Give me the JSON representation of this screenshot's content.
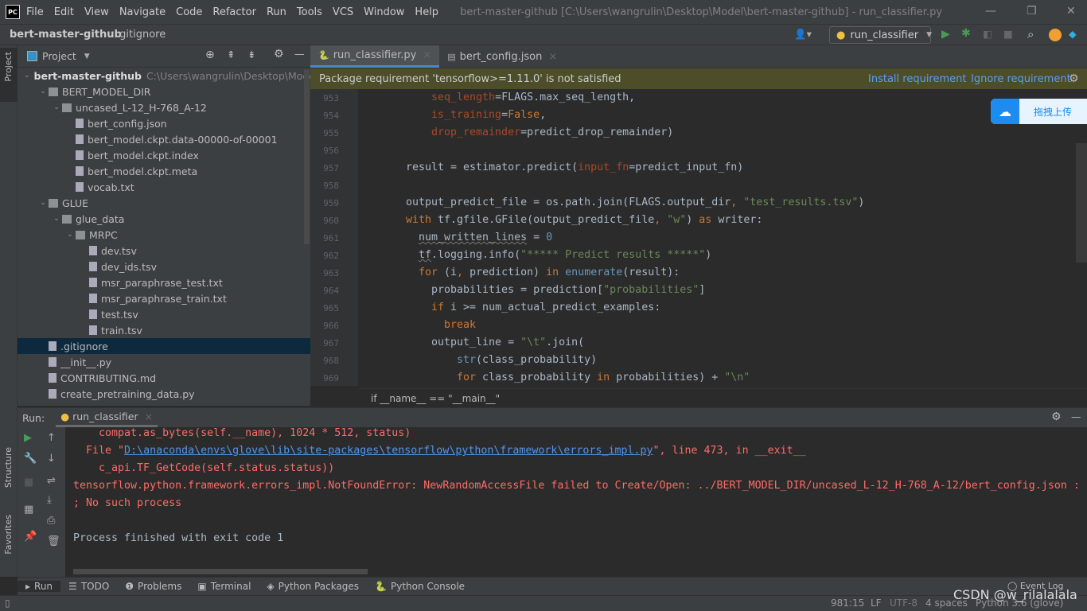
{
  "window": {
    "title": "bert-master-github [C:\\Users\\wangrulin\\Desktop\\Model\\bert-master-github] - run_classifier.py",
    "logo": "PC",
    "menu": [
      "File",
      "Edit",
      "View",
      "Navigate",
      "Code",
      "Refactor",
      "Run",
      "Tools",
      "VCS",
      "Window",
      "Help"
    ]
  },
  "nav": {
    "project": "bert-master-github",
    "file": ".gitignore",
    "run_config": "run_classifier"
  },
  "left_stripe": {
    "project": "Project",
    "structure": "Structure",
    "favorites": "Favorites"
  },
  "project": {
    "title": "Project",
    "tree": [
      {
        "label": "bert-master-github",
        "level": 0,
        "type": "folder",
        "expanded": true,
        "bold": true,
        "path": "C:\\Users\\wangrulin\\Desktop\\Model"
      },
      {
        "label": "BERT_MODEL_DIR",
        "level": 1,
        "type": "folder",
        "expanded": true
      },
      {
        "label": "uncased_L-12_H-768_A-12",
        "level": 2,
        "type": "folder",
        "expanded": true
      },
      {
        "label": "bert_config.json",
        "level": 3,
        "type": "file"
      },
      {
        "label": "bert_model.ckpt.data-00000-of-00001",
        "level": 3,
        "type": "file"
      },
      {
        "label": "bert_model.ckpt.index",
        "level": 3,
        "type": "file"
      },
      {
        "label": "bert_model.ckpt.meta",
        "level": 3,
        "type": "file"
      },
      {
        "label": "vocab.txt",
        "level": 3,
        "type": "file"
      },
      {
        "label": "GLUE",
        "level": 1,
        "type": "folder",
        "expanded": true
      },
      {
        "label": "glue_data",
        "level": 2,
        "type": "folder",
        "expanded": true
      },
      {
        "label": "MRPC",
        "level": 3,
        "type": "folder",
        "expanded": true
      },
      {
        "label": "dev.tsv",
        "level": 4,
        "type": "file"
      },
      {
        "label": "dev_ids.tsv",
        "level": 4,
        "type": "file"
      },
      {
        "label": "msr_paraphrase_test.txt",
        "level": 4,
        "type": "file"
      },
      {
        "label": "msr_paraphrase_train.txt",
        "level": 4,
        "type": "file"
      },
      {
        "label": "test.tsv",
        "level": 4,
        "type": "file"
      },
      {
        "label": "train.tsv",
        "level": 4,
        "type": "file"
      },
      {
        "label": ".gitignore",
        "level": 1,
        "type": "file",
        "selected": true
      },
      {
        "label": "__init__.py",
        "level": 1,
        "type": "file"
      },
      {
        "label": "CONTRIBUTING.md",
        "level": 1,
        "type": "file"
      },
      {
        "label": "create_pretraining_data.py",
        "level": 1,
        "type": "file"
      }
    ]
  },
  "editor": {
    "tabs": [
      {
        "label": "run_classifier.py",
        "active": true
      },
      {
        "label": "bert_config.json",
        "active": false
      }
    ],
    "banner": {
      "text": "Package requirement 'tensorflow>=1.11.0' is not satisfied",
      "install": "Install requirement",
      "ignore": "Ignore requirement"
    },
    "breadcrumb": "if __name__ == \"__main__\"",
    "lines": [
      {
        "n": "953",
        "i": 4,
        "s": [
          [
            "seq_length",
            "par"
          ],
          [
            "=FLAGS.max_seq_length,",
            ""
          ]
        ]
      },
      {
        "n": "954",
        "i": 4,
        "s": [
          [
            "is_training",
            "par"
          ],
          [
            "=",
            ""
          ],
          [
            "False",
            "kw"
          ],
          [
            ",",
            ""
          ]
        ]
      },
      {
        "n": "955",
        "i": 4,
        "s": [
          [
            "drop_remainder",
            "par"
          ],
          [
            "=predict_drop_remainder)",
            ""
          ]
        ]
      },
      {
        "n": "956",
        "i": 0,
        "s": []
      },
      {
        "n": "957",
        "i": 2,
        "s": [
          [
            "result = estimator.predict(",
            ""
          ],
          [
            "input_fn",
            "par"
          ],
          [
            "=predict_input_fn)",
            ""
          ]
        ]
      },
      {
        "n": "958",
        "i": 0,
        "s": []
      },
      {
        "n": "959",
        "i": 2,
        "s": [
          [
            "output_predict_file = os.path.join(FLAGS.output_dir",
            ""
          ],
          [
            ", ",
            "kw"
          ],
          [
            "\"test_results.tsv\"",
            "str"
          ],
          [
            ")",
            ""
          ]
        ]
      },
      {
        "n": "960",
        "i": 2,
        "s": [
          [
            "with ",
            "kw"
          ],
          [
            "tf.gfile.GFile(output_predict_file",
            ""
          ],
          [
            ", ",
            "kw"
          ],
          [
            "\"w\"",
            "str"
          ],
          [
            ") ",
            ""
          ],
          [
            "as ",
            "kw"
          ],
          [
            "writer:",
            ""
          ]
        ]
      },
      {
        "n": "961",
        "i": 3,
        "s": [
          [
            "num_written_lines",
            "u"
          ],
          [
            " = ",
            ""
          ],
          [
            "0",
            "num"
          ]
        ]
      },
      {
        "n": "962",
        "i": 3,
        "s": [
          [
            "tf",
            "u"
          ],
          [
            ".logging.info(",
            ""
          ],
          [
            "\"***** Predict results *****\"",
            "str"
          ],
          [
            ")",
            ""
          ]
        ]
      },
      {
        "n": "963",
        "i": 3,
        "s": [
          [
            "for ",
            "kw"
          ],
          [
            "(i",
            ""
          ],
          [
            ", ",
            "kw"
          ],
          [
            "prediction) ",
            ""
          ],
          [
            "in ",
            "kw"
          ],
          [
            "enumerate",
            "num"
          ],
          [
            "(result):",
            ""
          ]
        ]
      },
      {
        "n": "964",
        "i": 4,
        "s": [
          [
            "probabilities = prediction[",
            ""
          ],
          [
            "\"probabilities\"",
            "str"
          ],
          [
            "]",
            ""
          ]
        ]
      },
      {
        "n": "965",
        "i": 4,
        "s": [
          [
            "if ",
            "kw"
          ],
          [
            "i >= num_actual_predict_examples:",
            ""
          ]
        ]
      },
      {
        "n": "966",
        "i": 5,
        "s": [
          [
            "break",
            "kw"
          ]
        ]
      },
      {
        "n": "967",
        "i": 4,
        "s": [
          [
            "output_line = ",
            ""
          ],
          [
            "\"\\t\"",
            "str"
          ],
          [
            ".join(",
            ""
          ]
        ]
      },
      {
        "n": "968",
        "i": 6,
        "s": [
          [
            "str",
            "num"
          ],
          [
            "(class_probability)",
            ""
          ]
        ]
      },
      {
        "n": "969",
        "i": 6,
        "s": [
          [
            "for ",
            "kw"
          ],
          [
            "class_probability ",
            ""
          ],
          [
            "in ",
            "kw"
          ],
          [
            "probabilities) + ",
            ""
          ],
          [
            "\"\\n\"",
            "str"
          ]
        ]
      }
    ]
  },
  "overlay": {
    "upload": "拖拽上传"
  },
  "run": {
    "label": "Run:",
    "tab": "run_classifier",
    "console": [
      [
        [
          "    compat.as_bytes(self.__name), 1024 * 512, status)",
          ""
        ]
      ],
      [
        [
          "  File \"",
          ""
        ],
        [
          "D:\\anaconda\\envs\\glove\\lib\\site-packages\\tensorflow\\python\\framework\\errors_impl.py",
          "link"
        ],
        [
          "\", line 473, in __exit__",
          ""
        ]
      ],
      [
        [
          "    c_api.TF_GetCode(self.status.status))",
          ""
        ]
      ],
      [
        [
          "tensorflow.python.framework.errors_impl.NotFoundError: NewRandomAccessFile failed to Create/Open: ../BERT_MODEL_DIR/uncased_L-12_H-768_A-12/bert_config.json : ",
          ""
        ]
      ],
      [
        [
          "; No such process",
          ""
        ]
      ],
      [
        [
          "",
          ""
        ]
      ],
      [
        [
          "Process finished with exit code 1",
          "ok"
        ]
      ]
    ]
  },
  "toolwindows": [
    "Run",
    "TODO",
    "Problems",
    "Terminal",
    "Python Packages",
    "Python Console"
  ],
  "event_log": "Event Log",
  "status": {
    "position": "981:15",
    "line_sep": "LF",
    "encoding": "UTF-8",
    "indent": "4 spaces",
    "interpreter": "Python 3.6 (glove)",
    "watermark": "CSDN @w_rilalalala"
  }
}
